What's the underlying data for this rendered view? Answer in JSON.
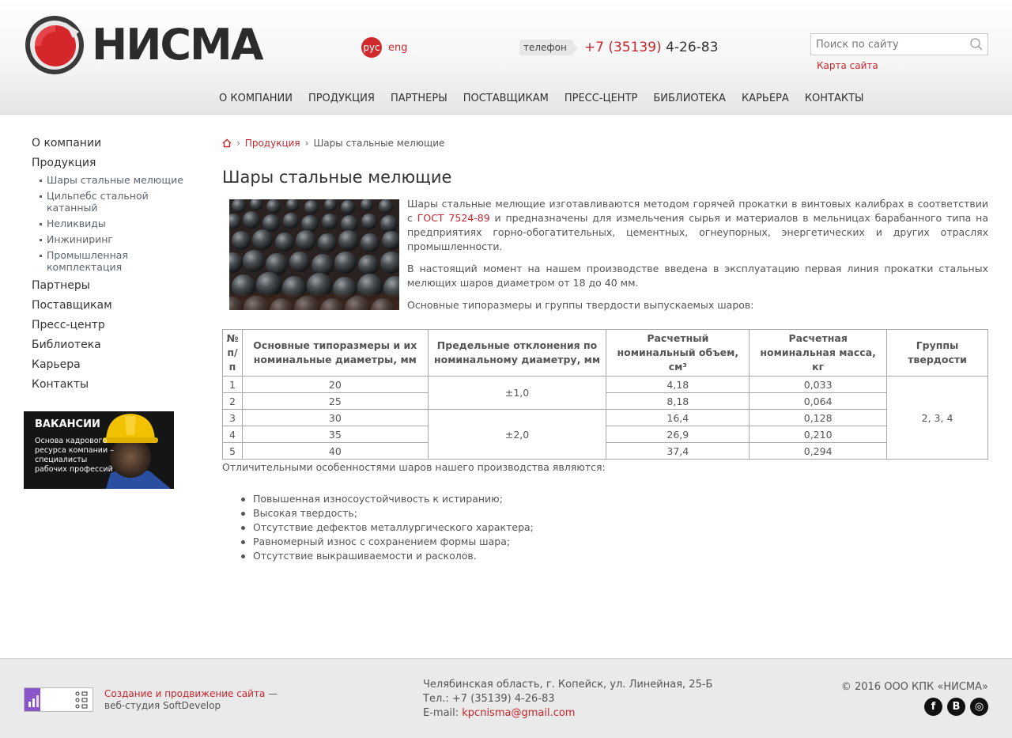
{
  "header": {
    "logo_text": "НИСМА",
    "lang_ru": "рус",
    "lang_en": "eng",
    "phone_label": "телефон",
    "phone_code": "+7 (35139)",
    "phone_number": "4-26-83",
    "search_placeholder": "Поиск по сайту",
    "sitemap": "Карта сайта",
    "nav": [
      "О КОМПАНИИ",
      "ПРОДУКЦИЯ",
      "ПАРТНЕРЫ",
      "ПОСТАВЩИКАМ",
      "ПРЕСС-ЦЕНТР",
      "БИБЛИОТЕКА",
      "КАРЬЕРА",
      "КОНТАКТЫ"
    ]
  },
  "sidebar": {
    "items": [
      "О компании",
      "Продукция",
      "Партнеры",
      "Поставщикам",
      "Пресс-центр",
      "Библиотека",
      "Карьера",
      "Контакты"
    ],
    "sub_items": [
      "Шары стальные мелющие",
      "Цильпебс стальной катанный",
      "Неликвиды",
      "Инжиниринг",
      "Промышленная комплектация"
    ],
    "vacancy_title": "ВАКАНСИИ",
    "vacancy_text": "Основа кадрового ресурса компании – специалисты рабочих профессий"
  },
  "breadcrumb": {
    "level1": "Продукция",
    "current": "Шары стальные мелющие"
  },
  "main": {
    "title": "Шары стальные мелющие",
    "p1_before": "Шары стальные мелющие изготавливаются методом горячей прокатки в винтовых калибрах в соответствии с ",
    "p1_link": "ГОСТ 7524-89",
    "p1_after": " и предназначены для измельчения сырья и материалов в мельницах барабанного типа на предприятиях горно-обогатительных, цементных, огнеупорных, энергетических и других отраслях промышленности.",
    "p2": "В настоящий момент на нашем производстве введена в эксплуатацию первая линия прокатки стальных мелющих шаров диаметром от 18 до 40 мм.",
    "p3": "Основные типоразмеры и группы твердости выпускаемых шаров:",
    "after_table": "Отличительными особенностями шаров нашего производства являются:",
    "features": [
      "Повышенная износоустойчивость к истиранию;",
      "Высокая твердость;",
      "Отсутствие дефектов металлургического характера;",
      "Равномерный износ с сохранением формы шара;",
      "Отсутствие выкрашиваемости и расколов."
    ]
  },
  "table": {
    "headers": [
      "№ п/п",
      "Основные типоразмеры и их номинальные диаметры, мм",
      "Предельные отклонения по номинальному диаметру, мм",
      "Расчетный номинальный объем, см³",
      "Расчетная номинальная масса, кг",
      "Группы твердости"
    ],
    "rows": [
      {
        "n": "1",
        "d": "20",
        "v": "4,18",
        "m": "0,033"
      },
      {
        "n": "2",
        "d": "25",
        "v": "8,18",
        "m": "0,064"
      },
      {
        "n": "3",
        "d": "30",
        "v": "16,4",
        "m": "0,128"
      },
      {
        "n": "4",
        "d": "35",
        "v": "26,9",
        "m": "0,210"
      },
      {
        "n": "5",
        "d": "40",
        "v": "37,4",
        "m": "0,294"
      }
    ],
    "tol1": "±1,0",
    "tol2": "±2,0",
    "hardness": "2, 3, 4"
  },
  "footer": {
    "dev_link": "Создание и продвижение сайта",
    "dev_dash": " —",
    "dev_studio": "веб-студия SoftDevelop",
    "address": "Челябинская область, г. Копейск, ул. Линейная, 25-Б",
    "tel": "Тел.: +7 (35139) 4-26-83",
    "email_label": "E-mail: ",
    "email": "kpcnisma@gmail.com",
    "copyright": "© 2016 ООО КПК «НИСМА»",
    "social": [
      "f",
      "B",
      "◎"
    ]
  }
}
